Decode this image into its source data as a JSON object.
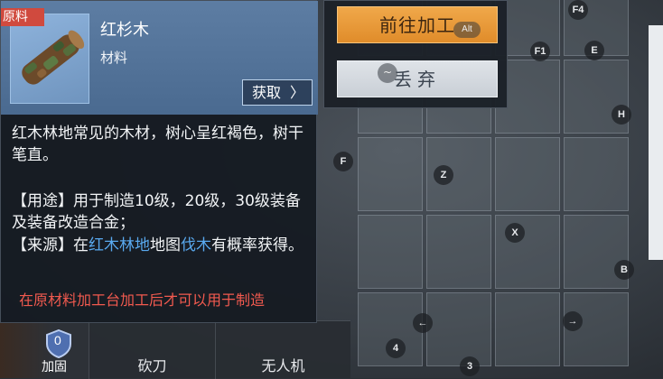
{
  "item": {
    "tag": "原料",
    "name": "红杉木",
    "type": "材料",
    "obtain_label": "获取",
    "description": "红木林地常见的木材，树心呈红褐色，树干笔直。",
    "usage_prefix": "【用途】",
    "usage_text": "用于制造10级，20级，30级装备及装备改造合金；",
    "source_prefix": "【来源】",
    "source_text_1": "在",
    "source_link_1": "红木林地",
    "source_text_2": "地图",
    "source_link_2": "伐木",
    "source_text_3": "有概率获得。",
    "warning": "在原材料加工台加工后才可以用于制造",
    "link_color": "#59a9ef",
    "warning_color": "#f25a4f"
  },
  "actions": {
    "process_label": "前往加工",
    "process_hotkey": "Alt",
    "discard_label": "丢弃",
    "discard_hotkey": "~"
  },
  "hotkeys": {
    "f4": "F4",
    "f1": "F1",
    "e": "E",
    "h": "H",
    "f": "F",
    "z": "Z",
    "x": "X",
    "b": "B",
    "left": "←",
    "right": "→",
    "four": "4",
    "three": "3"
  },
  "bottom_bar": {
    "shield_count": "0",
    "shield_label": "加固",
    "slot_1": "砍刀",
    "slot_2": "无人机"
  },
  "colors": {
    "accent_orange": "#e89a38",
    "panel_blue": "#5677a0"
  }
}
